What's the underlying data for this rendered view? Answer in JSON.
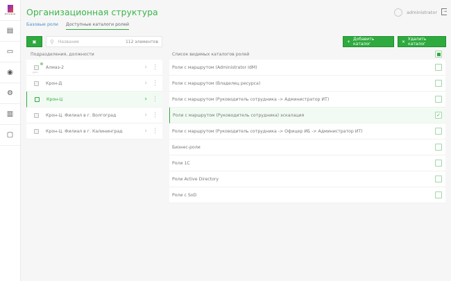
{
  "header": {
    "title": "Организационная структура",
    "user": "administrator"
  },
  "tabs": [
    {
      "label": "Базовые роли"
    },
    {
      "label": "Доступные каталоги ролей",
      "active": true
    }
  ],
  "search": {
    "placeholder": "Название",
    "count": "112 элементов"
  },
  "buttons": {
    "add": "Добавить каталог",
    "remove": "Удалить каталог"
  },
  "left": {
    "header": "Подразделения, должности",
    "items": [
      {
        "label": "Алмаз-2",
        "badge": "ручн.",
        "selected": false
      },
      {
        "label": "Крон-Д",
        "selected": false
      },
      {
        "label": "Крон-Ц",
        "selected": true
      },
      {
        "label": "Крон-Ц. Филиал в г. Волгоград",
        "selected": false
      },
      {
        "label": "Крон-Ц. Филиал в г. Калининград",
        "selected": false
      }
    ]
  },
  "right": {
    "header": "Список видимых каталогов ролей",
    "items": [
      {
        "label": "Роли с маршрутом (Administrator IdM)",
        "checked": false
      },
      {
        "label": "Роли с маршрутом (Владелец ресурса)",
        "checked": false
      },
      {
        "label": "Роли с маршрутом (Руководитель сотрудника -> Администратор ИТ)",
        "checked": false
      },
      {
        "label": "Роли с маршрутом (Руководитель сотрудника) эскалация",
        "checked": true
      },
      {
        "label": "Роли с маршрутом (Руководитель сотрудника -> Офицер ИБ -> Администратор ИТ)",
        "checked": false
      },
      {
        "label": "Бизнес-роли",
        "checked": false
      },
      {
        "label": "Роли 1С",
        "checked": false
      },
      {
        "label": "Роли Active Directory",
        "checked": false
      },
      {
        "label": "Роли с SoD",
        "checked": false
      }
    ]
  },
  "sidebar": {
    "logo": "Ростелеком",
    "icons": [
      "catalog-icon",
      "monitor-icon",
      "eye-icon",
      "gear-icon",
      "chart-icon",
      "message-icon"
    ]
  },
  "colors": {
    "accent": "#2eaa3e",
    "title": "#3cb54a",
    "link": "#4a90c8"
  }
}
